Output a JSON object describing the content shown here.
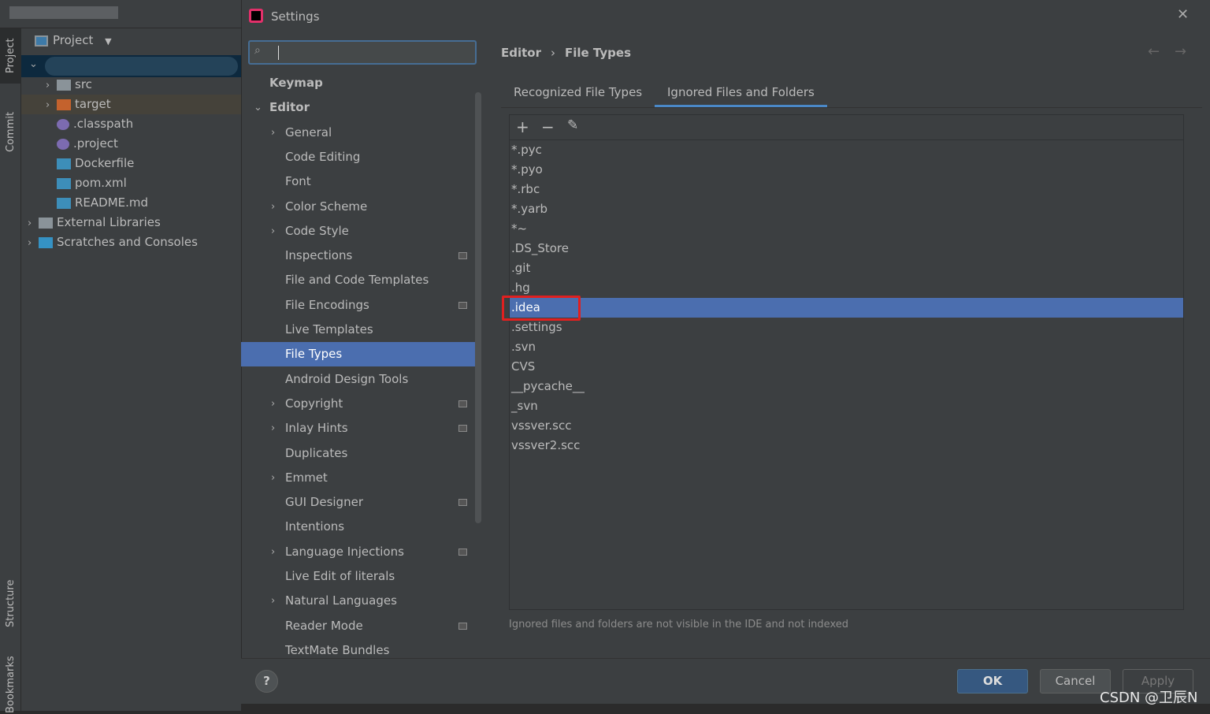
{
  "ide": {
    "tool_tabs": [
      "Project",
      "Commit",
      "Structure",
      "Bookmarks"
    ],
    "project_header": "Project",
    "tree": [
      {
        "label": "src",
        "chev": true,
        "indent": 1,
        "icon": "folder-icon",
        "color": "#8a9399"
      },
      {
        "label": "target",
        "chev": true,
        "indent": 1,
        "icon": "folder-icon",
        "color": "#c4622d",
        "highlight": true
      },
      {
        "label": ".classpath",
        "indent": 1,
        "icon": "eclipse-icon",
        "color": "#7c6bb0"
      },
      {
        "label": ".project",
        "indent": 1,
        "icon": "eclipse-icon",
        "color": "#7c6bb0"
      },
      {
        "label": "Dockerfile",
        "indent": 1,
        "icon": "docker-file-icon",
        "color": "#3d8eb9"
      },
      {
        "label": "pom.xml",
        "indent": 1,
        "icon": "maven-icon",
        "color": "#3d8eb9"
      },
      {
        "label": "README.md",
        "indent": 1,
        "icon": "markdown-icon",
        "color": "#3d8eb9"
      },
      {
        "label": "External Libraries",
        "chev": true,
        "indent": 0,
        "icon": "libraries-icon",
        "color": "#8a9399"
      },
      {
        "label": "Scratches and Consoles",
        "chev": true,
        "indent": 0,
        "icon": "scratches-icon",
        "color": "#3592c4"
      }
    ]
  },
  "dialog": {
    "title": "Settings",
    "search_value": "",
    "nav": [
      {
        "label": "Keymap",
        "bold": true,
        "level": 0
      },
      {
        "label": "Editor",
        "bold": true,
        "level": 0,
        "expanded": true
      },
      {
        "label": "General",
        "level": 1,
        "chev": true
      },
      {
        "label": "Code Editing",
        "level": 1
      },
      {
        "label": "Font",
        "level": 1
      },
      {
        "label": "Color Scheme",
        "level": 1,
        "chev": true
      },
      {
        "label": "Code Style",
        "level": 1,
        "chev": true
      },
      {
        "label": "Inspections",
        "level": 1,
        "proj": true
      },
      {
        "label": "File and Code Templates",
        "level": 1
      },
      {
        "label": "File Encodings",
        "level": 1,
        "proj": true
      },
      {
        "label": "Live Templates",
        "level": 1
      },
      {
        "label": "File Types",
        "level": 1,
        "selected": true
      },
      {
        "label": "Android Design Tools",
        "level": 1
      },
      {
        "label": "Copyright",
        "level": 1,
        "chev": true,
        "proj": true
      },
      {
        "label": "Inlay Hints",
        "level": 1,
        "chev": true,
        "proj": true
      },
      {
        "label": "Duplicates",
        "level": 1
      },
      {
        "label": "Emmet",
        "level": 1,
        "chev": true
      },
      {
        "label": "GUI Designer",
        "level": 1,
        "proj": true
      },
      {
        "label": "Intentions",
        "level": 1
      },
      {
        "label": "Language Injections",
        "level": 1,
        "chev": true,
        "proj": true
      },
      {
        "label": "Live Edit of literals",
        "level": 1
      },
      {
        "label": "Natural Languages",
        "level": 1,
        "chev": true
      },
      {
        "label": "Reader Mode",
        "level": 1,
        "proj": true
      },
      {
        "label": "TextMate Bundles",
        "level": 1
      }
    ],
    "breadcrumb": [
      "Editor",
      "File Types"
    ],
    "tabs": [
      {
        "label": "Recognized File Types"
      },
      {
        "label": "Ignored Files and Folders",
        "active": true
      }
    ],
    "toolbar": [
      "add-icon",
      "remove-icon",
      "edit-icon"
    ],
    "ignored": [
      "*.pyc",
      "*.pyo",
      "*.rbc",
      "*.yarb",
      "*~",
      ".DS_Store",
      ".git",
      ".hg",
      ".idea",
      ".settings",
      ".svn",
      "CVS",
      "__pycache__",
      "_svn",
      "vssver.scc",
      "vssver2.scc"
    ],
    "selected_item": ".idea",
    "hint": "Ignored files and folders are not visible in the IDE and not indexed",
    "buttons": {
      "ok": "OK",
      "cancel": "Cancel",
      "apply": "Apply"
    },
    "help": "?"
  },
  "watermark": "CSDN @卫辰N",
  "colors": {
    "selection": "#4b6eaf",
    "highlight_box": "#e02020",
    "accent": "#4a88c7"
  }
}
